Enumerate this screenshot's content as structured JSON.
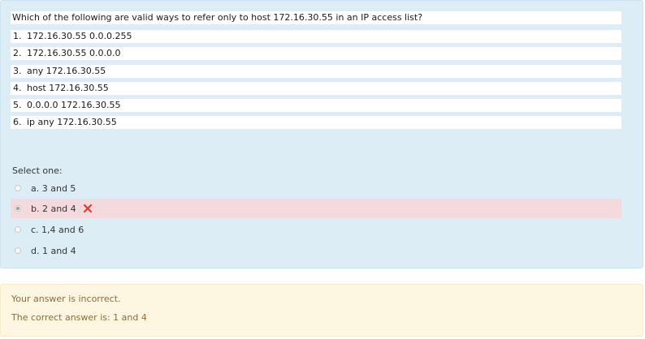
{
  "question": {
    "text": "Which of the following are valid ways to refer only to host 172.16.30.55 in an IP access list?",
    "options": [
      {
        "num": "1.",
        "text": "172.16.30.55 0.0.0.255"
      },
      {
        "num": "2.",
        "text": "172.16.30.55 0.0.0.0"
      },
      {
        "num": "3.",
        "text": "any 172.16.30.55"
      },
      {
        "num": "4.",
        "text": "host 172.16.30.55"
      },
      {
        "num": "5.",
        "text": "0.0.0.0 172.16.30.55"
      },
      {
        "num": "6.",
        "text": "ip any 172.16.30.55"
      }
    ]
  },
  "answer": {
    "prompt": "Select one:",
    "choices": [
      {
        "label": "a. 3 and 5",
        "selected": false
      },
      {
        "label": "b. 2 and 4",
        "selected": true,
        "status": "incorrect"
      },
      {
        "label": "c. 1,4 and 6",
        "selected": false
      },
      {
        "label": "d. 1 and 4",
        "selected": false
      }
    ]
  },
  "feedback": {
    "result": "Your answer is incorrect.",
    "correct": "The correct answer is: 1 and 4"
  },
  "colors": {
    "question_bg": "#dcedf6",
    "selected_bg": "#f4dadd",
    "wrong_icon": "#e53935",
    "feedback_bg": "#fdf6e0",
    "feedback_text": "#8a6d3b"
  },
  "icons": {
    "wrong": "close-x-icon"
  }
}
